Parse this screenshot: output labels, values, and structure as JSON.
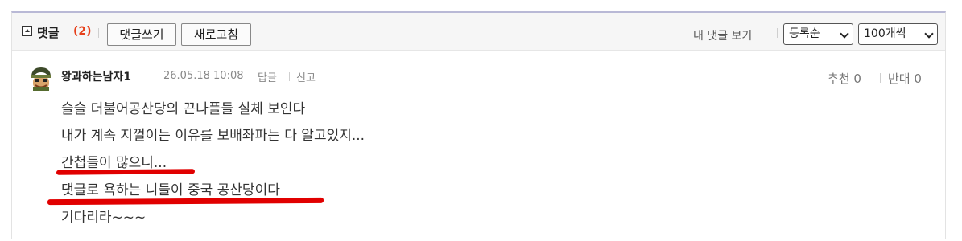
{
  "header": {
    "title": "댓글",
    "count": "(2)",
    "write_button": "댓글쓰기",
    "refresh_button": "새로고침",
    "my_comments": "내 댓글 보기",
    "sort_select": "등록순",
    "per_page_select": "100개씩"
  },
  "comment": {
    "author": "왕과하는남자1",
    "date": "26.05.18 10:08",
    "reply": "답글",
    "report": "신고",
    "upvote_label": "추천",
    "upvote_count": "0",
    "downvote_label": "반대",
    "downvote_count": "0",
    "lines": [
      "슬슬 더불어공산당의 끈나플들 실체 보인다",
      "내가 계속 지껄이는 이유를 보배좌파는 다 알고있지...",
      "간첩들이 많으니...",
      "댓글로 욕하는 니들이 중국 공산당이다",
      "기다리라~~~"
    ]
  },
  "colors": {
    "accent_count": "#e6401b",
    "annotation_red": "#e10000",
    "top_border": "#b9b9d6"
  }
}
